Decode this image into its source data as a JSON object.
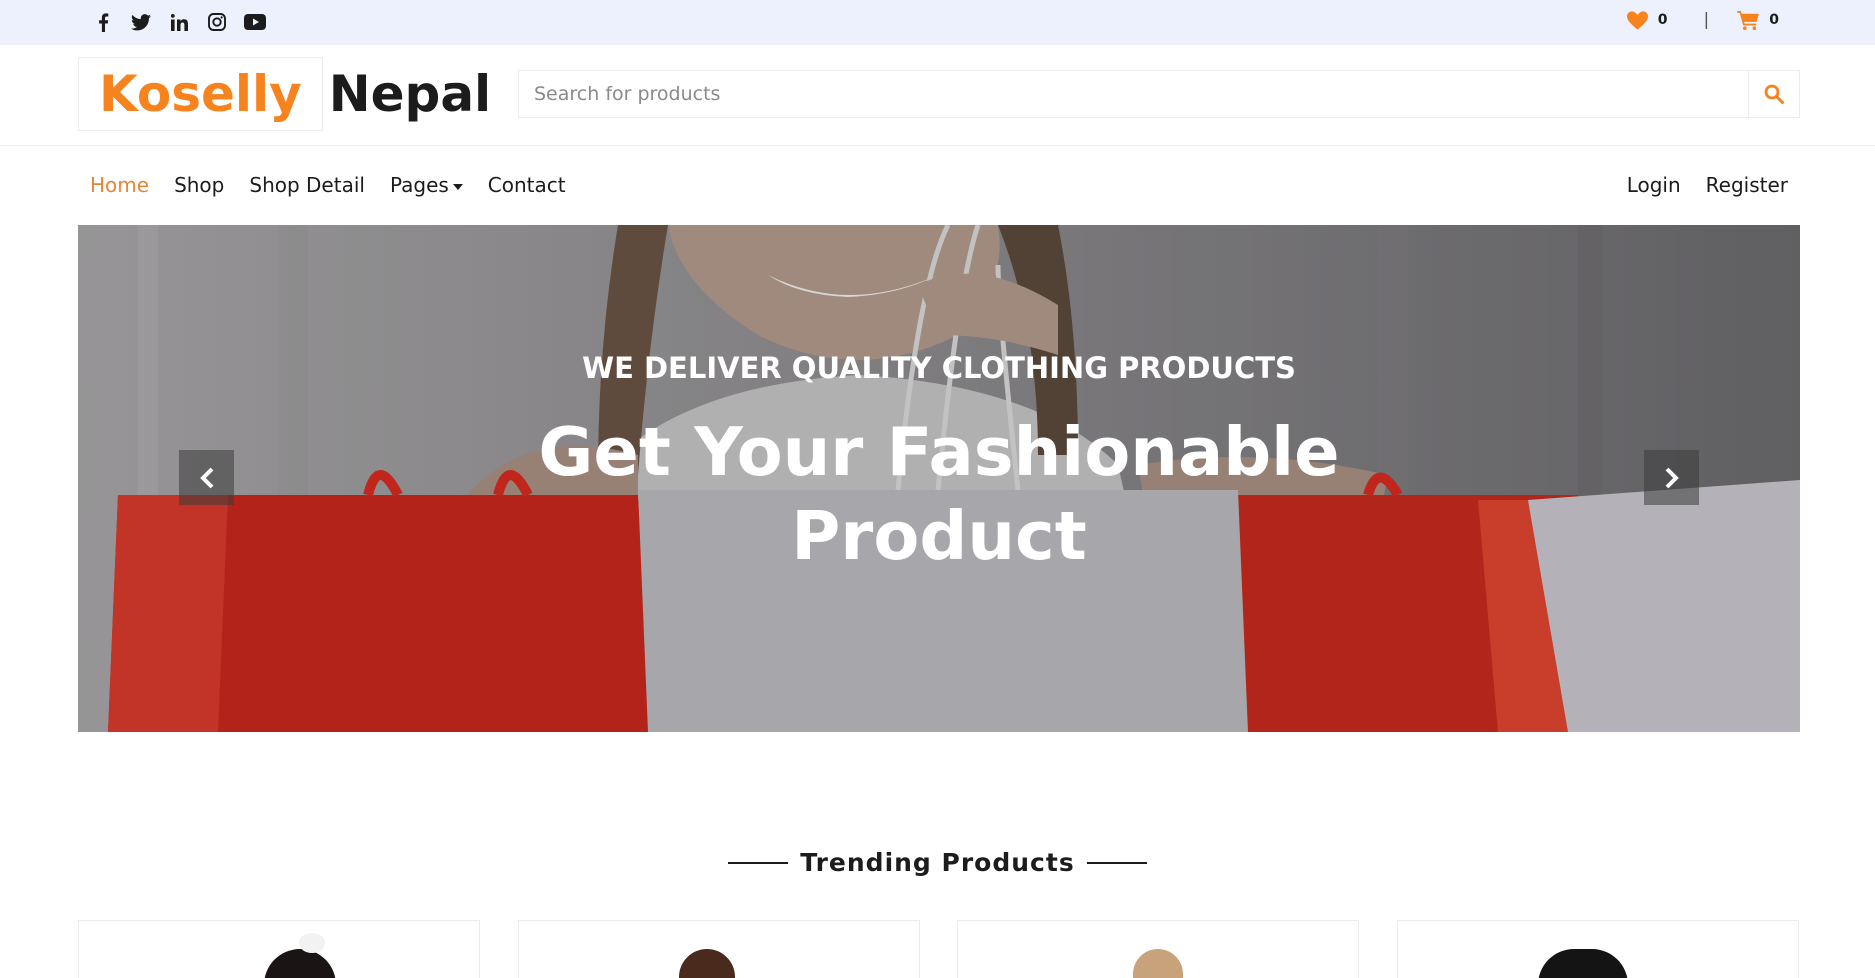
{
  "topbar": {
    "social_icons": [
      "facebook-icon",
      "twitter-icon",
      "linkedin-icon",
      "instagram-icon",
      "youtube-icon"
    ],
    "wishlist_count": "0",
    "separator": "|",
    "cart_count": "0"
  },
  "header": {
    "logo_part1": "Koselly",
    "logo_part2": "Nepal",
    "search_placeholder": "Search for products"
  },
  "nav": {
    "items": [
      {
        "label": "Home",
        "active": true
      },
      {
        "label": "Shop"
      },
      {
        "label": "Shop Detail"
      },
      {
        "label": "Pages"
      },
      {
        "label": "Contact"
      }
    ],
    "login": "Login",
    "register": "Register"
  },
  "hero": {
    "subtitle": "WE DELIVER QUALITY CLOTHING PRODUCTS",
    "title_line1": "Get Your Fashionable",
    "title_line2": "Product"
  },
  "trending": {
    "title": "Trending Products"
  },
  "colors": {
    "accent": "#f7831f",
    "topbar_bg": "#edf1fd",
    "text": "#1c1c1c"
  }
}
